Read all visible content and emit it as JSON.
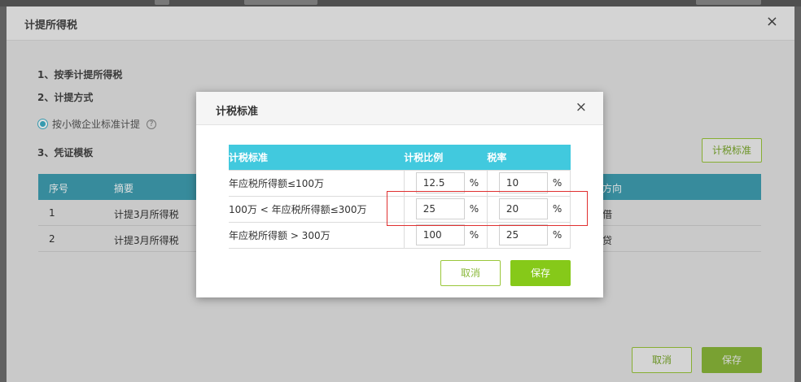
{
  "outer_dialog": {
    "title": "计提所得税",
    "close_symbol": "×",
    "steps": [
      {
        "label": "1、按季计提所得税"
      },
      {
        "label": "2、计提方式"
      },
      {
        "label": "3、凭证模板"
      }
    ],
    "method_option": "按小微企业标准计提",
    "help_symbol": "?",
    "tax_standard_button": "计税标准",
    "voucher_table": {
      "columns": [
        "序号",
        "摘要",
        "方向"
      ],
      "rows": [
        {
          "index": "1",
          "summary": "计提3月所得税",
          "direction": "借"
        },
        {
          "index": "2",
          "summary": "计提3月所得税",
          "direction": "贷"
        }
      ]
    },
    "cancel_label": "取消",
    "save_label": "保存"
  },
  "modal": {
    "title": "计税标准",
    "close_symbol": "×",
    "table": {
      "columns": [
        "计税标准",
        "计税比例",
        "税率"
      ],
      "rows": [
        {
          "standard": "年应税所得额≤100万",
          "ratio": "12.5",
          "rate": "10"
        },
        {
          "standard": "100万 < 年应税所得额≤300万",
          "ratio": "25",
          "rate": "20"
        },
        {
          "standard": "年应税所得额 > 300万",
          "ratio": "100",
          "rate": "25"
        }
      ],
      "percent_symbol": "%"
    },
    "cancel_label": "取消",
    "save_label": "保存"
  },
  "colors": {
    "header_teal": "#41c9de",
    "accent_green": "#86c919",
    "highlight_red": "#e03030"
  }
}
